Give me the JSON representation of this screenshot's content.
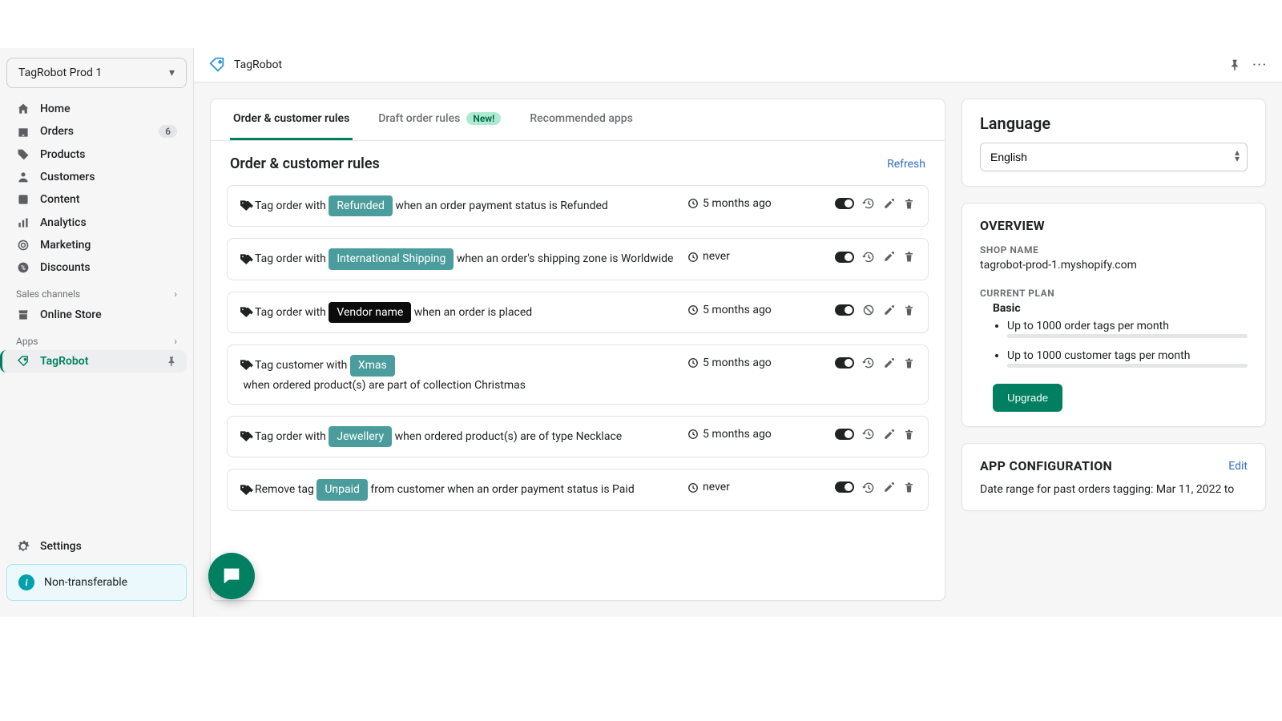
{
  "store_selector": {
    "name": "TagRobot Prod 1"
  },
  "nav": {
    "home": "Home",
    "orders": "Orders",
    "orders_badge": "6",
    "products": "Products",
    "customers": "Customers",
    "content": "Content",
    "analytics": "Analytics",
    "marketing": "Marketing",
    "discounts": "Discounts",
    "sales_channels": "Sales channels",
    "online_store": "Online Store",
    "apps": "Apps",
    "tagrobot": "TagRobot",
    "settings": "Settings"
  },
  "info_banner": "Non-transferable",
  "topbar": {
    "title": "TagRobot"
  },
  "tabs": {
    "order_customer": "Order & customer rules",
    "draft": "Draft order rules",
    "draft_badge": "New!",
    "recommended": "Recommended apps"
  },
  "rules_header": {
    "title": "Order & customer rules",
    "refresh": "Refresh"
  },
  "rules": [
    {
      "pre": "Tag order with ",
      "tag": "Refunded",
      "tagStyle": "teal",
      "post": " when an order payment status is Refunded",
      "time": "5 months ago",
      "secondIcon": "history"
    },
    {
      "pre": "Tag order with ",
      "tag": "International Shipping",
      "tagStyle": "teal",
      "post": " when an order's shipping zone is Worldwide",
      "time": "never",
      "secondIcon": "history"
    },
    {
      "pre": "Tag order with ",
      "tag": "Vendor name",
      "tagStyle": "black",
      "post": " when an order is placed",
      "time": "5 months ago",
      "secondIcon": "block"
    },
    {
      "pre": "Tag customer with ",
      "tag": "Xmas",
      "tagStyle": "teal",
      "post": " when ordered product(s) are part of collection Christmas",
      "time": "5 months ago",
      "secondIcon": "history"
    },
    {
      "pre": "Tag order with ",
      "tag": "Jewellery",
      "tagStyle": "teal",
      "post": " when ordered product(s) are of type Necklace",
      "time": "5 months ago",
      "secondIcon": "history"
    },
    {
      "pre": "Remove tag ",
      "tag": "Unpaid",
      "tagStyle": "teal",
      "post": " from customer when an order payment status is Paid",
      "time": "never",
      "secondIcon": "history"
    }
  ],
  "language": {
    "heading": "Language",
    "value": "English"
  },
  "overview": {
    "heading": "OVERVIEW",
    "shop_label": "SHOP NAME",
    "shop_value": "tagrobot-prod-1.myshopify.com",
    "plan_label": "CURRENT PLAN",
    "plan_name": "Basic",
    "feature1": "Up to 1000 order tags per month",
    "feature2": "Up to 1000 customer tags per month",
    "upgrade": "Upgrade"
  },
  "appcfg": {
    "heading": "APP CONFIGURATION",
    "edit": "Edit",
    "text": "Date range for past orders tagging: Mar 11, 2022 to"
  }
}
